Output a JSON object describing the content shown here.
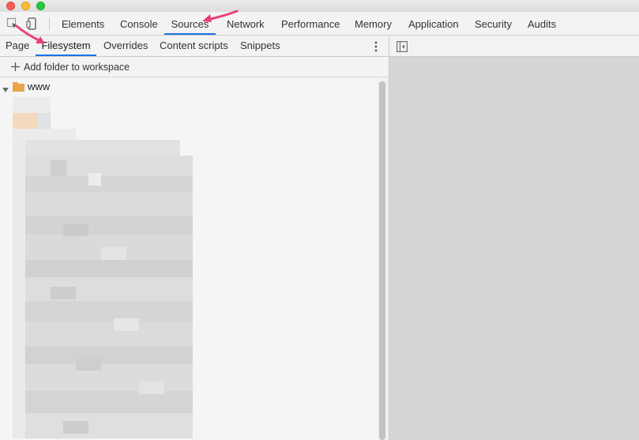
{
  "toolbar": {
    "icons": [
      "inspect-element-icon",
      "device-toolbar-icon"
    ],
    "tabs": [
      {
        "label": "Elements"
      },
      {
        "label": "Console"
      },
      {
        "label": "Sources",
        "active": true
      },
      {
        "label": "Network"
      },
      {
        "label": "Performance"
      },
      {
        "label": "Memory"
      },
      {
        "label": "Application"
      },
      {
        "label": "Security"
      },
      {
        "label": "Audits"
      }
    ]
  },
  "navigator": {
    "tabs": [
      {
        "label": "Page"
      },
      {
        "label": "Filesystem",
        "active": true
      },
      {
        "label": "Overrides"
      },
      {
        "label": "Content scripts"
      },
      {
        "label": "Snippets"
      }
    ],
    "more_icon": "more-vertical-icon",
    "add_folder_label": "Add folder to workspace",
    "tree": {
      "folder_label": "www",
      "expanded": true
    }
  },
  "editor": {
    "toggle_icon": "toggle-sidebar-icon"
  },
  "colors": {
    "active_tab_underline": "#1a73e8",
    "folder": "#e8a54b",
    "annotation_arrow": "#e8417a",
    "editor_background": "#d6d6d6"
  }
}
